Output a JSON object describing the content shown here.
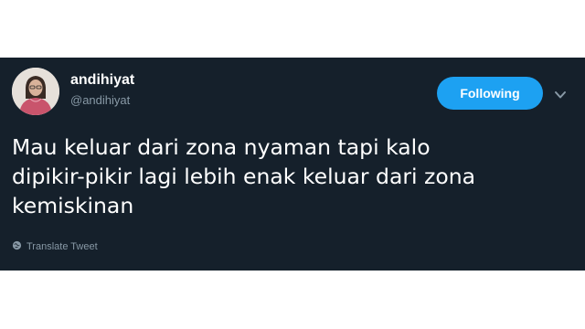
{
  "tweet": {
    "author_name": "andihiyat",
    "author_handle": "@andihiyat",
    "follow_label": "Following",
    "text": "Mau keluar dari zona nyaman tapi kalo\ndipikir-pikir lagi lebih enak keluar dari zona\nkemiskinan",
    "translate_label": "Translate Tweet"
  },
  "icons": {
    "more": "chevron-down-icon",
    "translate": "globe-icon"
  },
  "colors": {
    "background": "#15202b",
    "accent": "#1da1f2",
    "muted": "#8899a6",
    "text": "#ffffff"
  }
}
